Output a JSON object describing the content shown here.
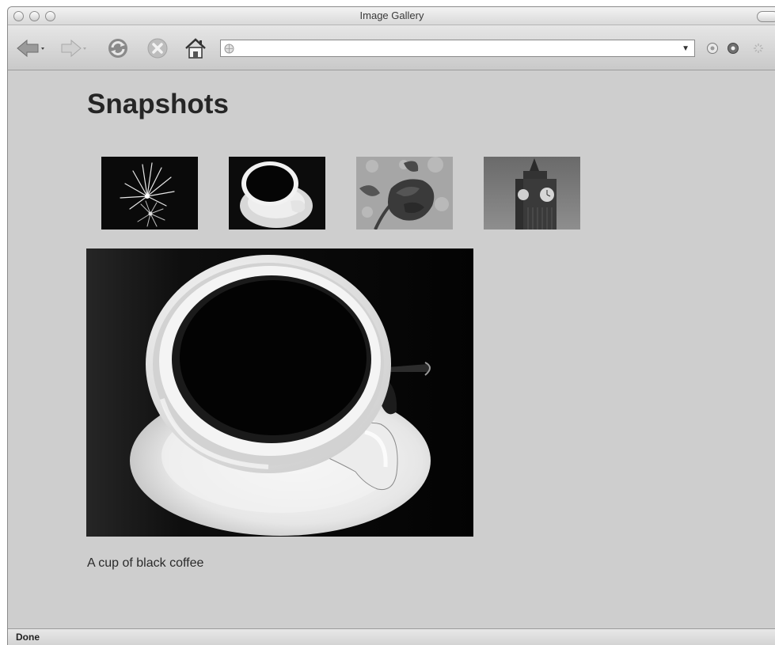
{
  "window": {
    "title": "Image Gallery"
  },
  "toolbar": {
    "back_icon": "back-arrow-icon",
    "forward_icon": "forward-arrow-icon",
    "reload_icon": "reload-icon",
    "stop_icon": "stop-icon",
    "home_icon": "home-icon",
    "address_value": "",
    "address_placeholder": ""
  },
  "page": {
    "heading": "Snapshots",
    "thumbnails": [
      {
        "subject": "fireworks"
      },
      {
        "subject": "coffee cup"
      },
      {
        "subject": "rose"
      },
      {
        "subject": "Big Ben clock tower"
      }
    ],
    "caption": "A cup of black coffee"
  },
  "status": {
    "text": "Done"
  }
}
